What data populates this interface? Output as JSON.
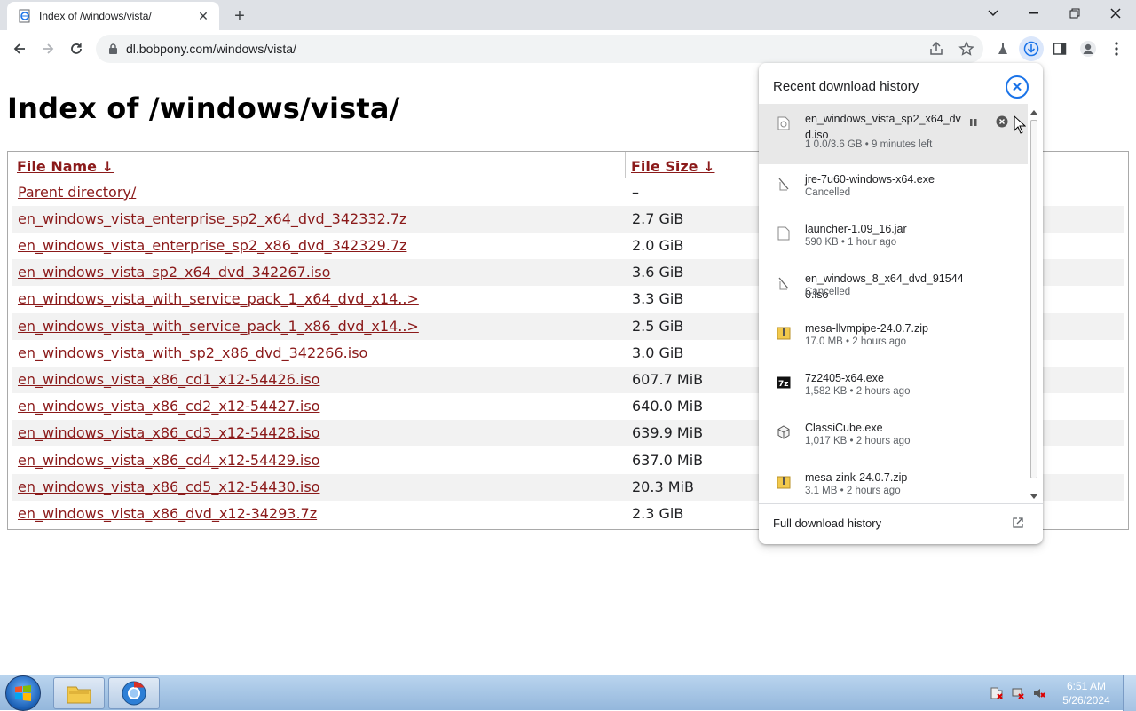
{
  "browser": {
    "tab_title": "Index of /windows/vista/",
    "address": "dl.bobpony.com/windows/vista/"
  },
  "page": {
    "title": "Index of /windows/vista/",
    "headers": {
      "name": "File Name  ↓",
      "size": "File Size  ↓"
    },
    "rows": [
      {
        "name": "Parent directory/",
        "size": "–"
      },
      {
        "name": "en_windows_vista_enterprise_sp2_x64_dvd_342332.7z",
        "size": "2.7 GiB"
      },
      {
        "name": "en_windows_vista_enterprise_sp2_x86_dvd_342329.7z",
        "size": "2.0 GiB"
      },
      {
        "name": "en_windows_vista_sp2_x64_dvd_342267.iso",
        "size": "3.6 GiB"
      },
      {
        "name": "en_windows_vista_with_service_pack_1_x64_dvd_x14..>",
        "size": "3.3 GiB"
      },
      {
        "name": "en_windows_vista_with_service_pack_1_x86_dvd_x14..>",
        "size": "2.5 GiB"
      },
      {
        "name": "en_windows_vista_with_sp2_x86_dvd_342266.iso",
        "size": "3.0 GiB"
      },
      {
        "name": "en_windows_vista_x86_cd1_x12-54426.iso",
        "size": "607.7 MiB"
      },
      {
        "name": "en_windows_vista_x86_cd2_x12-54427.iso",
        "size": "640.0 MiB"
      },
      {
        "name": "en_windows_vista_x86_cd3_x12-54428.iso",
        "size": "639.9 MiB"
      },
      {
        "name": "en_windows_vista_x86_cd4_x12-54429.iso",
        "size": "637.0 MiB"
      },
      {
        "name": "en_windows_vista_x86_cd5_x12-54430.iso",
        "size": "20.3 MiB"
      },
      {
        "name": "en_windows_vista_x86_dvd_x12-34293.7z",
        "size": "2.3 GiB"
      }
    ]
  },
  "downloads": {
    "title": "Recent download history",
    "items": [
      {
        "name": "en_windows_vista_sp2_x64_dvd.iso",
        "status": "1 0.0/3.6 GB • 9 minutes left",
        "icon": "file-downloading-icon"
      },
      {
        "name": "jre-7u60-windows-x64.exe",
        "status": "Cancelled",
        "icon": "cancelled-file-icon"
      },
      {
        "name": "launcher-1.09_16.jar",
        "status": "590 KB • 1 hour ago",
        "icon": "file-icon"
      },
      {
        "name": "en_windows_8_x64_dvd_915440.iso",
        "status": "Cancelled",
        "icon": "cancelled-file-icon"
      },
      {
        "name": "mesa-llvmpipe-24.0.7.zip",
        "status": "17.0 MB • 2 hours ago",
        "icon": "zip-folder-icon"
      },
      {
        "name": "7z2405-x64.exe",
        "status": "1,582 KB • 2 hours ago",
        "icon": "7zip-icon"
      },
      {
        "name": "ClassiCube.exe",
        "status": "1,017 KB • 2 hours ago",
        "icon": "cube-icon"
      },
      {
        "name": "mesa-zink-24.0.7.zip",
        "status": "3.1 MB • 2 hours ago",
        "icon": "zip-folder-icon"
      }
    ],
    "footer": "Full download history"
  },
  "taskbar": {
    "time": "6:51 AM",
    "date": "5/26/2024"
  },
  "colors": {
    "link": "#8b1a1a",
    "accent": "#1a73e8",
    "taskbar": "#a6c3e3"
  }
}
